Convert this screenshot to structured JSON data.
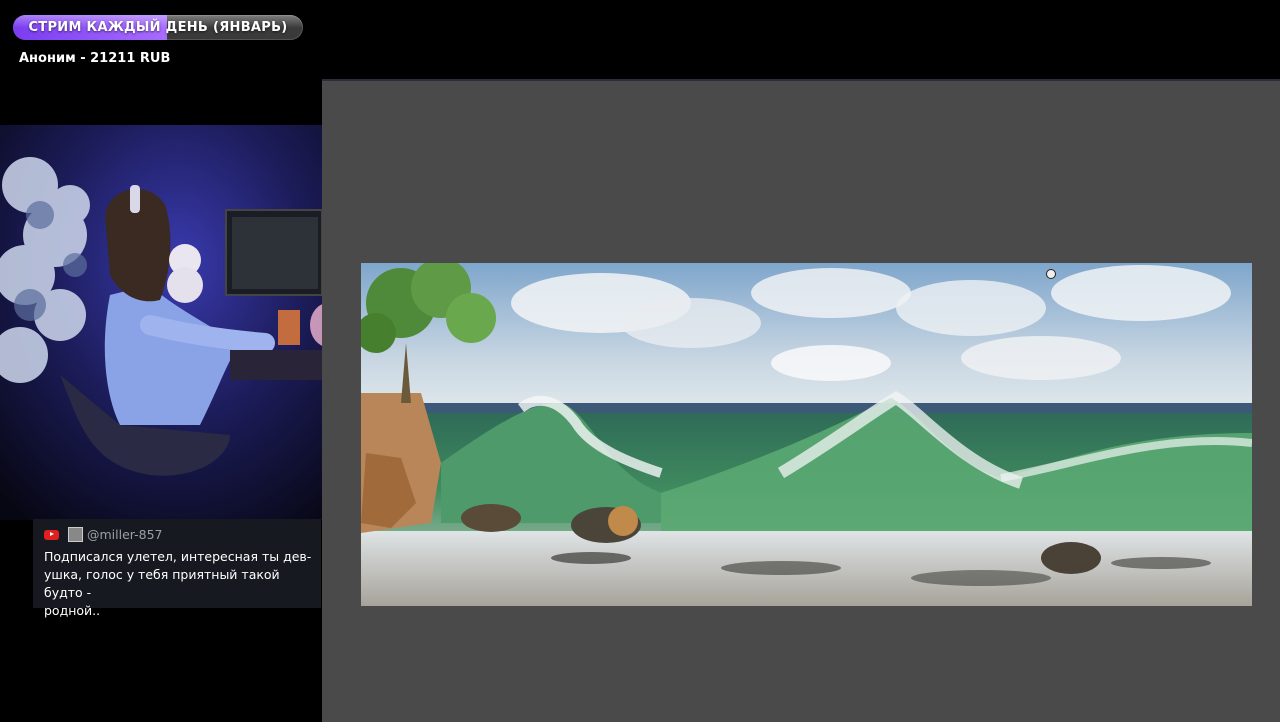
{
  "goal": {
    "label": "СТРИМ КАЖДЫЙ ДЕНЬ (ЯНВАРЬ)",
    "progress_percent": 53,
    "color": "#8a4cf5"
  },
  "donation": {
    "text": "Аноним - 21211 RUB"
  },
  "chat": {
    "platform_icon": "youtube-icon",
    "username": "@miller-857",
    "message_lines": [
      "Подписался улетел, интересная ты дев-",
      "ушка, голос у тебя приятный такой будто -",
      "родной.."
    ]
  },
  "canvas": {
    "background": "#4a4a4a"
  }
}
